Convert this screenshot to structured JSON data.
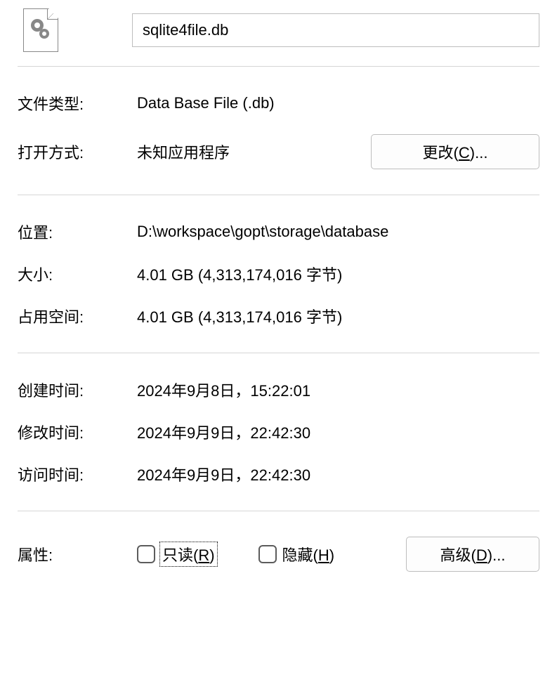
{
  "filename": "sqlite4file.db",
  "labels": {
    "file_type": "文件类型:",
    "open_with": "打开方式:",
    "location": "位置:",
    "size": "大小:",
    "size_on_disk": "占用空间:",
    "created": "创建时间:",
    "modified": "修改时间:",
    "accessed": "访问时间:",
    "attributes": "属性:"
  },
  "values": {
    "file_type": "Data Base File (.db)",
    "open_with": "未知应用程序",
    "location": "D:\\workspace\\gopt\\storage\\database",
    "size": "4.01 GB (4,313,174,016 字节)",
    "size_on_disk": "4.01 GB (4,313,174,016 字节)",
    "created": "2024年9月8日，15:22:01",
    "modified": "2024年9月9日，22:42:30",
    "accessed": "2024年9月9日，22:42:30"
  },
  "buttons": {
    "change_prefix": "更改(",
    "change_key": "C",
    "change_suffix": ")...",
    "advanced_prefix": "高级(",
    "advanced_key": "D",
    "advanced_suffix": ")..."
  },
  "checkboxes": {
    "readonly_prefix": "只读(",
    "readonly_key": "R",
    "readonly_suffix": ")",
    "readonly_checked": false,
    "hidden_prefix": "隐藏(",
    "hidden_key": "H",
    "hidden_suffix": ")",
    "hidden_checked": false
  }
}
